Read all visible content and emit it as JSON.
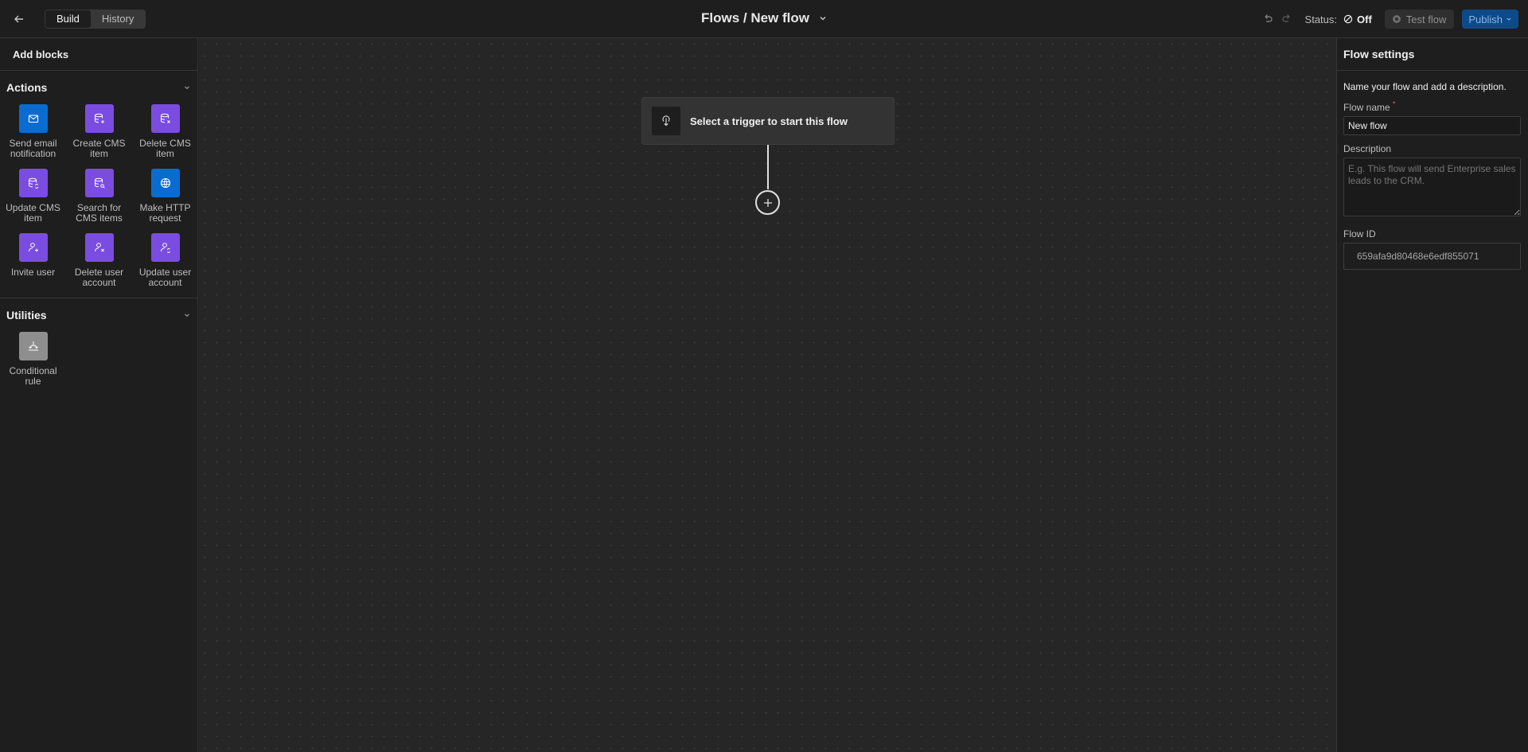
{
  "topbar": {
    "tabs": [
      {
        "label": "Build"
      },
      {
        "label": "History"
      }
    ],
    "title": "Flows / New flow",
    "status_label": "Status:",
    "status_value": "Off",
    "test_label": "Test flow",
    "publish_label": "Publish"
  },
  "left_panel": {
    "header": "Add blocks",
    "actions": {
      "title": "Actions",
      "items": [
        {
          "label": "Send email notification",
          "icon": "mail-icon"
        },
        {
          "label": "Create CMS item",
          "icon": "database-plus-icon"
        },
        {
          "label": "Delete CMS item",
          "icon": "database-x-icon"
        },
        {
          "label": "Update CMS item",
          "icon": "database-refresh-icon"
        },
        {
          "label": "Search for CMS items",
          "icon": "database-search-icon"
        },
        {
          "label": "Make HTTP request",
          "icon": "globe-icon"
        },
        {
          "label": "Invite user",
          "icon": "user-plus-icon"
        },
        {
          "label": "Delete user account",
          "icon": "user-x-icon"
        },
        {
          "label": "Update user account",
          "icon": "user-refresh-icon"
        }
      ]
    },
    "utilities": {
      "title": "Utilities",
      "items": [
        {
          "label": "Conditional rule",
          "icon": "branch-icon"
        }
      ]
    }
  },
  "canvas": {
    "trigger_text": "Select a trigger to start this flow"
  },
  "right_panel": {
    "header": "Flow settings",
    "description": "Name your flow and add a description.",
    "name_label": "Flow name",
    "name_required": "*",
    "name_value": "New flow",
    "description_label": "Description",
    "description_placeholder": "E.g. This flow will send Enterprise sales leads to the CRM.",
    "id_label": "Flow ID",
    "id_value": "659afa9d80468e6edf855071"
  },
  "colors": {
    "blue": "#0a6cd1",
    "purple": "#7b4ce0",
    "publish": "#0d4a8a"
  }
}
